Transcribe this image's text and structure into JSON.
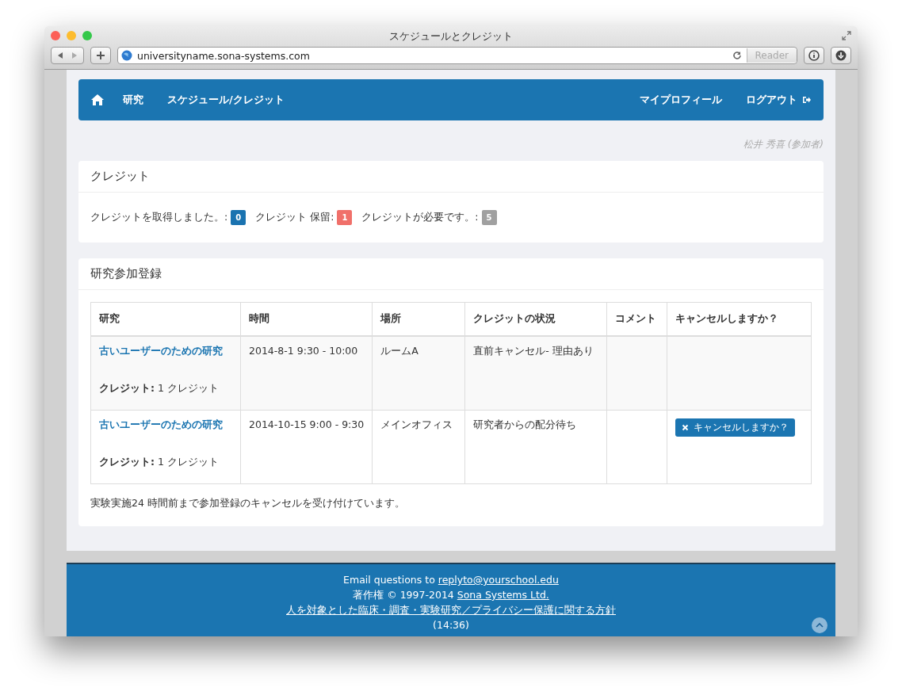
{
  "window": {
    "title": "スケジュールとクレジット",
    "url": "universityname.sona-systems.com",
    "reader_button": "Reader"
  },
  "navbar": {
    "left": [
      {
        "label": "研究"
      },
      {
        "label": "スケジュール/クレジット"
      }
    ],
    "right": [
      {
        "label": "マイプロフィール"
      },
      {
        "label": "ログアウト"
      }
    ]
  },
  "user": "松井 秀喜 (参加者)",
  "credits": {
    "title": "クレジット",
    "items": [
      {
        "label": "クレジットを取得しました。:",
        "value": "0",
        "color": "#1a73b0"
      },
      {
        "label": "クレジット 保留:",
        "value": "1",
        "color": "#f0706a"
      },
      {
        "label": "クレジットが必要です。:",
        "value": "5",
        "color": "#a0a0a0"
      }
    ]
  },
  "signups": {
    "title": "研究参加登録",
    "columns": [
      "研究",
      "時間",
      "場所",
      "クレジットの状況",
      "コメント",
      "キャンセルしますか？"
    ],
    "rows": [
      {
        "study": "古いユーザーのための研究",
        "credit": "**クレジット:** 1 クレジット",
        "time": "2014-8-1 9:30 - 10:00",
        "location": "ルームA",
        "status": "直前キャンセル- 理由あり"
      },
      {
        "study": "古いユーザーのための研究",
        "credit": "**クレジット:** 1 クレジット",
        "time": "2014-10-15 9:00 - 9:30",
        "location": "メインオフィス",
        "status": "研究者からの配分待ち",
        "cancel_button": "キャンセルしますか？"
      }
    ],
    "note": "実験実施24 時間前まで参加登録のキャンセルを受け付けています。"
  },
  "footer": {
    "email_prefix": "Email questions to",
    "email": "replyto@yourschool.edu",
    "copyright": "著作権 © 1997-2014",
    "company": "Sona Systems Ltd.",
    "policy": "人を対象とした臨床・調査・実験研究／プライバシー保護に関する方針",
    "time": "(14:36)"
  }
}
